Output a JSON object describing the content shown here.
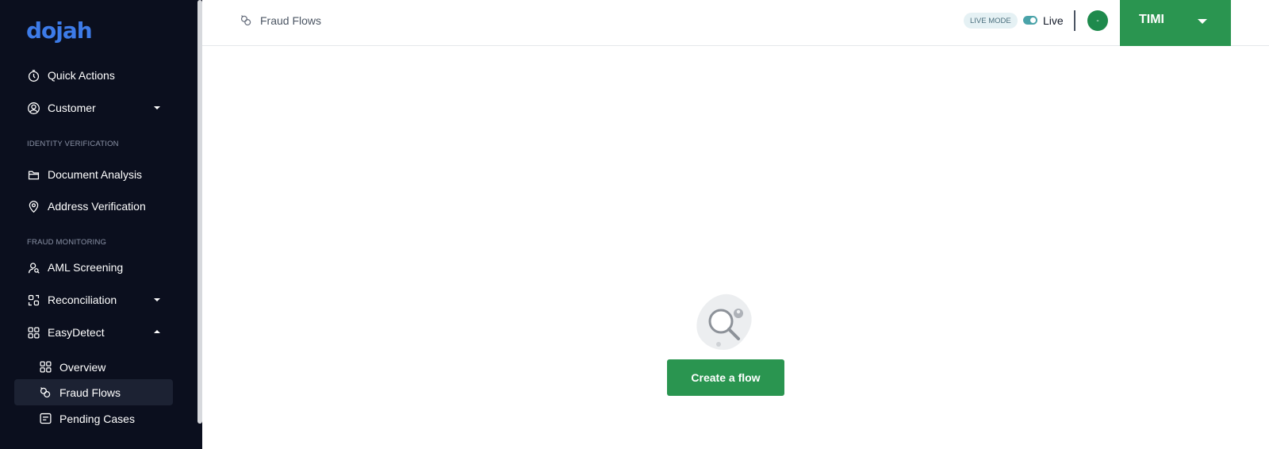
{
  "brand": {
    "logo_text": "dojah",
    "accent": "#2a9550",
    "logo_color": "#3d7be8"
  },
  "sidebar": {
    "items": [
      {
        "label": "Quick Actions",
        "icon": "timer-icon"
      },
      {
        "label": "Customer",
        "icon": "user-circle-icon",
        "caret": "down"
      },
      {
        "label": "Document Analysis",
        "icon": "folder-icon"
      },
      {
        "label": "Address Verification",
        "icon": "location-pin-icon"
      },
      {
        "label": "AML Screening",
        "icon": "person-search-icon"
      },
      {
        "label": "Reconciliation",
        "icon": "reconcile-icon",
        "caret": "down"
      },
      {
        "label": "EasyDetect",
        "icon": "grid-icon",
        "caret": "up"
      }
    ],
    "sections": {
      "identity": "IDENTITY VERIFICATION",
      "fraud": "FRAUD MONITORING"
    },
    "easydetect_children": [
      {
        "label": "Overview",
        "icon": "grid-icon"
      },
      {
        "label": "Fraud Flows",
        "icon": "flow-icon",
        "active": true
      },
      {
        "label": "Pending Cases",
        "icon": "cases-icon"
      }
    ]
  },
  "header": {
    "breadcrumb": "Fraud Flows",
    "mode_badge": "LIVE MODE",
    "mode_label": "Live",
    "avatar_initial": "-",
    "user_name": "TIMI"
  },
  "main": {
    "empty_icon": "empty-search-icon",
    "create_label": "Create a flow"
  }
}
